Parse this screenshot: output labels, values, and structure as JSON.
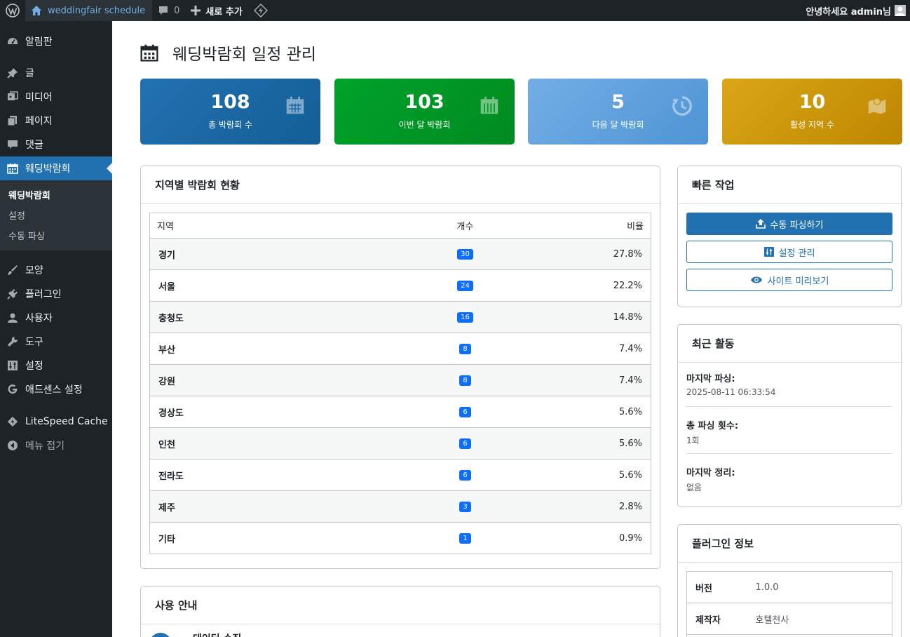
{
  "adminbar": {
    "site_name": "weddingfair schedule",
    "comments_count": "0",
    "new_label": "새로 추가",
    "greeting": "안녕하세요 admin님"
  },
  "sidebar": {
    "items_top": [
      {
        "id": "dashboard",
        "label": "알림판",
        "icon": "dashboard-icon"
      },
      {
        "id": "posts",
        "label": "글",
        "icon": "pin-icon"
      },
      {
        "id": "media",
        "label": "미디어",
        "icon": "media-icon"
      },
      {
        "id": "pages",
        "label": "페이지",
        "icon": "page-icon"
      },
      {
        "id": "comments",
        "label": "댓글",
        "icon": "comment-icon"
      },
      {
        "id": "weddingfair",
        "label": "웨딩박람회",
        "icon": "calendar-icon"
      }
    ],
    "submenu": [
      "웨딩박람회",
      "설정",
      "수동 파싱"
    ],
    "items_bottom": [
      {
        "id": "appearance",
        "label": "모양",
        "icon": "brush-icon"
      },
      {
        "id": "plugins",
        "label": "플러그인",
        "icon": "plugin-icon"
      },
      {
        "id": "users",
        "label": "사용자",
        "icon": "user-icon"
      },
      {
        "id": "tools",
        "label": "도구",
        "icon": "wrench-icon"
      },
      {
        "id": "settings",
        "label": "설정",
        "icon": "settings-icon"
      },
      {
        "id": "adsense",
        "label": "애드센스 설정",
        "icon": "google-icon"
      },
      {
        "id": "litespeed",
        "label": "LiteSpeed Cache",
        "icon": "litespeed-icon"
      }
    ],
    "collapse_label": "메뉴 접기"
  },
  "page": {
    "title": "웨딩박람회 일정 관리"
  },
  "stats": [
    {
      "value": "108",
      "label": "총 박람회 수",
      "icon": "calendar-icon",
      "color": "#2271b1"
    },
    {
      "value": "103",
      "label": "이번 달 박람회",
      "icon": "calendar-month-icon",
      "color": "#00a32a"
    },
    {
      "value": "5",
      "label": "다음 달 박람회",
      "icon": "history-icon",
      "color": "#72aee6"
    },
    {
      "value": "10",
      "label": "활성 지역 수",
      "icon": "map-icon",
      "color": "#dba617"
    }
  ],
  "region": {
    "title": "지역별 박람회 현황",
    "headers": [
      "지역",
      "개수",
      "비율"
    ],
    "rows": [
      {
        "name": "경기",
        "count": "30",
        "pct": "27.8%"
      },
      {
        "name": "서울",
        "count": "24",
        "pct": "22.2%"
      },
      {
        "name": "충청도",
        "count": "16",
        "pct": "14.8%"
      },
      {
        "name": "부산",
        "count": "8",
        "pct": "7.4%"
      },
      {
        "name": "강원",
        "count": "8",
        "pct": "7.4%"
      },
      {
        "name": "경상도",
        "count": "6",
        "pct": "5.6%"
      },
      {
        "name": "인천",
        "count": "6",
        "pct": "5.6%"
      },
      {
        "name": "전라도",
        "count": "6",
        "pct": "5.6%"
      },
      {
        "name": "제주",
        "count": "3",
        "pct": "2.8%"
      },
      {
        "name": "기타",
        "count": "1",
        "pct": "0.9%"
      }
    ]
  },
  "guide": {
    "title": "사용 안내",
    "first_item": "데이터 수집"
  },
  "quick": {
    "title": "빠른 작업",
    "buttons": [
      {
        "label": "수동 파싱하기",
        "icon": "upload-icon"
      },
      {
        "label": "설정 관리",
        "icon": "settings-icon"
      },
      {
        "label": "사이트 미리보기",
        "icon": "eye-icon"
      }
    ]
  },
  "recent": {
    "title": "최근 활동",
    "items": [
      {
        "label": "마지막 파싱:",
        "value": "2025-08-11 06:33:54"
      },
      {
        "label": "총 파싱 횟수:",
        "value": "1회"
      },
      {
        "label": "마지막 정리:",
        "value": "없음"
      }
    ]
  },
  "plugin_info": {
    "title": "플러그인 정보",
    "rows": [
      {
        "key": "버전",
        "value": "1.0.0"
      },
      {
        "key": "제작자",
        "value": "호텔천사"
      }
    ]
  }
}
